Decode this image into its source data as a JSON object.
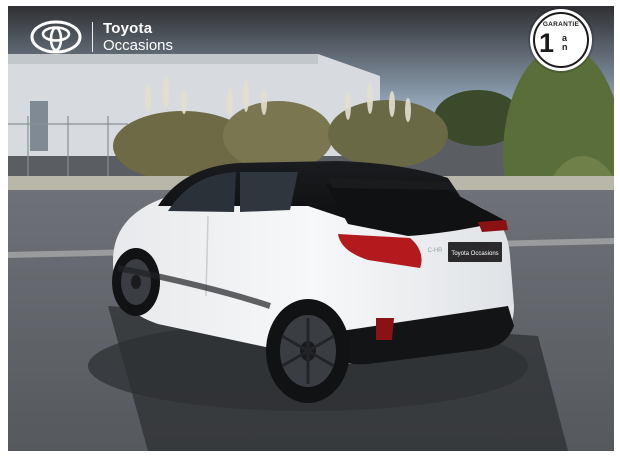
{
  "brand": {
    "name": "Toyota",
    "subtitle": "Occasions"
  },
  "badge": {
    "title": "GARANTIE",
    "number": "1",
    "unit_line1": "a",
    "unit_line2": "n"
  },
  "car": {
    "plate_text": "Toyota Occasions",
    "model_badge": "C-HR"
  }
}
